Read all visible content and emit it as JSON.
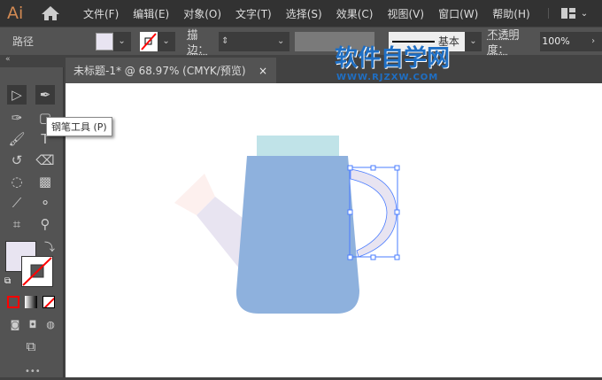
{
  "app": {
    "logo": "Ai"
  },
  "menu": [
    "文件(F)",
    "编辑(E)",
    "对象(O)",
    "文字(T)",
    "选择(S)",
    "效果(C)",
    "视图(V)",
    "窗口(W)",
    "帮助(H)"
  ],
  "control": {
    "selection": "路径",
    "stroke_label": "描边：",
    "style": "基本",
    "opacity_label": "不透明度：",
    "opacity": "100%",
    "fill_color": "#e8e4f1"
  },
  "document": {
    "tab": "未标题-1* @ 68.97% (CMYK/预览)",
    "close": "×"
  },
  "tooltip": "钢笔工具 (P)",
  "watermark": {
    "title": "软件自学网",
    "url": "WWW.RJZXW.COM"
  },
  "colors": {
    "lid": "#c0e3e8",
    "body": "#8eb1dd",
    "spout": "#e8e4f1",
    "spout_tip": "#fdf0ee",
    "selection": "#4a7cff"
  }
}
